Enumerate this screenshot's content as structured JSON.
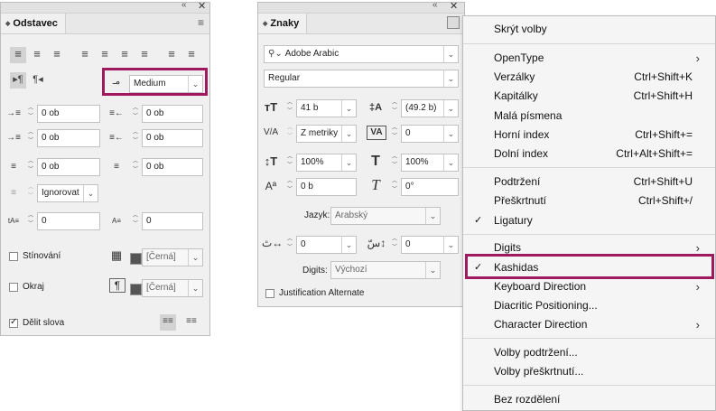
{
  "paragraph_panel": {
    "title": "Odstavec",
    "kashida_setting": "Medium",
    "indent_left": "0 ob",
    "indent_right": "0 ob",
    "first_line_indent": "0 ob",
    "last_line_indent": "0 ob",
    "space_before": "0 ob",
    "space_after": "0 ob",
    "align_to_grid": "Ignorovat",
    "drop_cap_lines": "0",
    "drop_cap_chars": "0",
    "shading_label": "Stínování",
    "shading_color": "[Černá]",
    "border_label": "Okraj",
    "border_color": "[Černá]",
    "hyphenate_label": "Dělit slova",
    "hyphenate_checked": true
  },
  "character_panel": {
    "title": "Znaky",
    "font_family": "Adobe Arabic",
    "font_style": "Regular",
    "font_size": "41 b",
    "leading": "(49.2 b)",
    "kerning": "Z metriky",
    "tracking": "0",
    "vertical_scale": "100%",
    "horizontal_scale": "100%",
    "baseline_shift": "0 b",
    "skew": "0°",
    "language_label": "Jazyk:",
    "language": "Arabský",
    "diacritic_x": "0",
    "diacritic_y": "0",
    "digits_label": "Digits:",
    "digits": "Výchozí",
    "justification_alternate": "Justification Alternate"
  },
  "menu": {
    "items": [
      {
        "label": "Skrýt volby",
        "shortcut": "",
        "check": false,
        "submenu": false
      },
      {
        "label": "OpenType",
        "shortcut": "",
        "check": false,
        "submenu": true
      },
      {
        "label": "Verzálky",
        "shortcut": "Ctrl+Shift+K",
        "check": false,
        "submenu": false
      },
      {
        "label": "Kapitálky",
        "shortcut": "Ctrl+Shift+H",
        "check": false,
        "submenu": false
      },
      {
        "label": "Malá písmena",
        "shortcut": "",
        "check": false,
        "submenu": false
      },
      {
        "label": "Horní index",
        "shortcut": "Ctrl+Shift+=",
        "check": false,
        "submenu": false
      },
      {
        "label": "Dolní index",
        "shortcut": "Ctrl+Alt+Shift+=",
        "check": false,
        "submenu": false
      },
      {
        "label": "Podtržení",
        "shortcut": "Ctrl+Shift+U",
        "check": false,
        "submenu": false
      },
      {
        "label": "Přeškrtnutí",
        "shortcut": "Ctrl+Shift+/",
        "check": false,
        "submenu": false
      },
      {
        "label": "Ligatury",
        "shortcut": "",
        "check": true,
        "submenu": false
      },
      {
        "label": "Digits",
        "shortcut": "",
        "check": false,
        "submenu": true
      },
      {
        "label": "Kashidas",
        "shortcut": "",
        "check": true,
        "submenu": false
      },
      {
        "label": "Keyboard Direction",
        "shortcut": "",
        "check": false,
        "submenu": true
      },
      {
        "label": "Diacritic Positioning...",
        "shortcut": "",
        "check": false,
        "submenu": false
      },
      {
        "label": "Character Direction",
        "shortcut": "",
        "check": false,
        "submenu": true
      },
      {
        "label": "Volby podtržení...",
        "shortcut": "",
        "check": false,
        "submenu": false
      },
      {
        "label": "Volby přeškrtnutí...",
        "shortcut": "",
        "check": false,
        "submenu": false
      },
      {
        "label": "Bez rozdělení",
        "shortcut": "",
        "check": false,
        "submenu": false
      }
    ]
  },
  "colors": {
    "highlight": "#a0195e",
    "panel_bg": "#f0f0f0",
    "menu_bg": "#f5f5f5"
  }
}
